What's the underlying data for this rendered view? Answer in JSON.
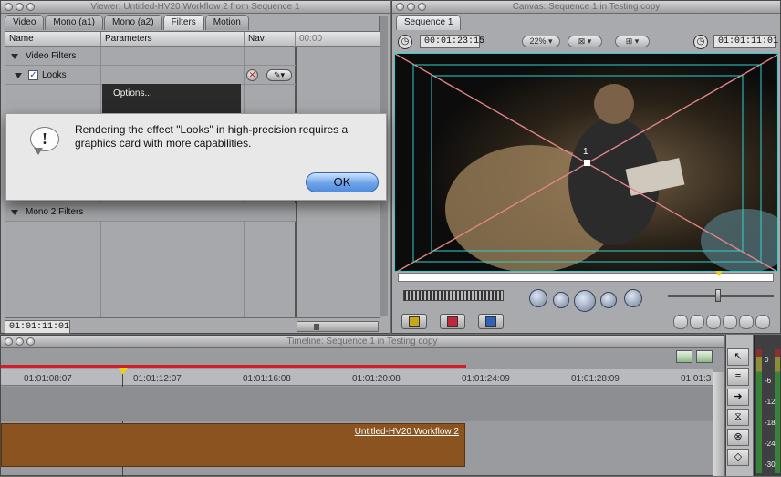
{
  "viewer": {
    "title": "Viewer: Untitled-HV20 Workflow 2 from Sequence 1",
    "tabs": [
      "Video",
      "Mono (a1)",
      "Mono (a2)",
      "Filters",
      "Motion"
    ],
    "active_tab": "Filters",
    "columns": {
      "name": "Name",
      "parameters": "Parameters",
      "nav": "Nav",
      "time": "00:00"
    },
    "rows": {
      "video_filters": "Video Filters",
      "looks": "Looks",
      "mono2_filters": "Mono 2 Filters"
    },
    "menu_item": "Options...",
    "timecode": "01:01:11:01"
  },
  "dialog": {
    "message": "Rendering the effect \"Looks\" in high-precision requires a graphics card with more capabilities.",
    "ok_label": "OK",
    "icon": "alert-bubble-icon"
  },
  "canvas": {
    "title": "Canvas: Sequence 1 in Testing copy",
    "tab": "Sequence 1",
    "duration": "00:01:23:15",
    "zoom": "22%",
    "current_time": "01:01:11:01",
    "overlay_marker": "1"
  },
  "timeline": {
    "title": "Timeline: Sequence 1 in Testing copy",
    "ruler": [
      "01:01:08:07",
      "01:01:12:07",
      "01:01:16:08",
      "01:01:20:08",
      "01:01:24:09",
      "01:01:28:09",
      "01:01:3"
    ],
    "clip_name": "Untitled-HV20 Workflow 2"
  },
  "meters": [
    "0",
    "-6",
    "-12",
    "-18",
    "-24",
    "-30"
  ],
  "colors": {
    "accent_cyan": "#2fd0d0",
    "clip_brown": "#8a531f",
    "playhead_yellow": "#e6d21a",
    "ok_blue": "#5d99e6"
  }
}
